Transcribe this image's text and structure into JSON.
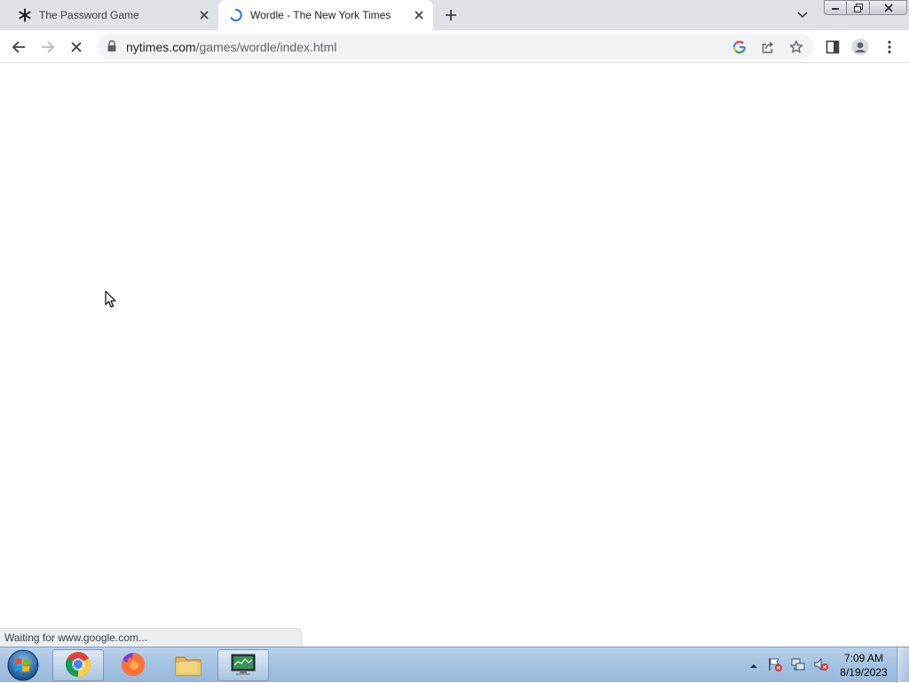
{
  "browser": {
    "tabs": [
      {
        "title": "The Password Game",
        "favicon": "asterisk-icon",
        "active": false
      },
      {
        "title": "Wordle - The New York Times",
        "favicon": "loading-spinner-icon",
        "active": true
      }
    ],
    "omnibox": {
      "domain": "nytimes.com",
      "path": "/games/wordle/index.html"
    },
    "status_text": "Waiting for www.google.com..."
  },
  "taskbar": {
    "pinned": [
      "chrome-icon",
      "firefox-icon",
      "file-explorer-icon",
      "network-monitor-icon"
    ],
    "clock": {
      "time": "7:09 AM",
      "date": "8/19/2023"
    }
  },
  "colors": {
    "tabstrip": "#dee1e6",
    "omnibox": "#f1f3f4",
    "accent_blue": "#1a73e8",
    "taskbar": "#a6c3e2"
  }
}
